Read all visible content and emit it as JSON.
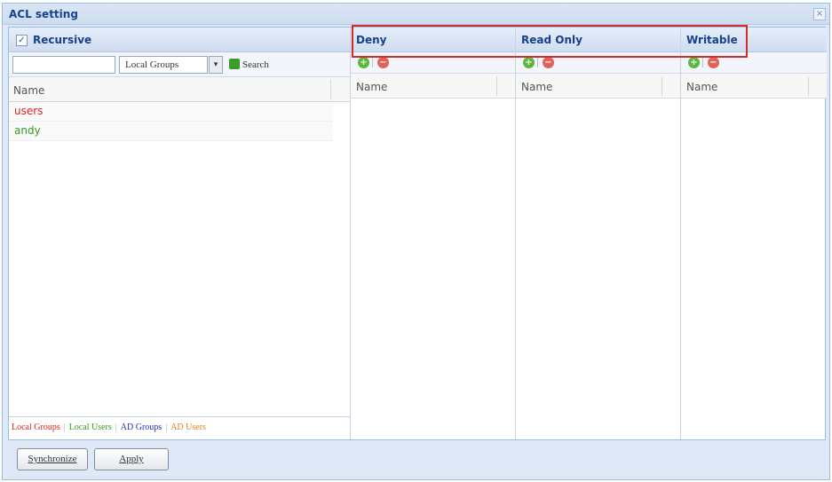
{
  "window": {
    "title": "ACL setting",
    "close_label": "×"
  },
  "left": {
    "recursive_checked": "✓",
    "recursive_label": "Recursive",
    "search_value": "",
    "group_select": "Local Groups",
    "select_arrow": "▾",
    "search_label": "Search",
    "column_name": "Name",
    "items": [
      {
        "label": "users",
        "color": "#e02020"
      },
      {
        "label": "andy",
        "color": "#3a9a20"
      }
    ]
  },
  "legend": [
    {
      "label": "Local Groups",
      "color": "#d92020"
    },
    {
      "label": "Local Users",
      "color": "#3a9a20"
    },
    {
      "label": "AD Groups",
      "color": "#2030c0"
    },
    {
      "label": "AD Users",
      "color": "#e08020"
    }
  ],
  "permissions": [
    {
      "title": "Deny",
      "column": "Name"
    },
    {
      "title": "Read Only",
      "column": "Name"
    },
    {
      "title": "Writable",
      "column": "Name"
    }
  ],
  "icons": {
    "add": "+",
    "remove": "−"
  },
  "footer": {
    "synchronize_label": "Synchronize",
    "apply_label": "Apply"
  }
}
